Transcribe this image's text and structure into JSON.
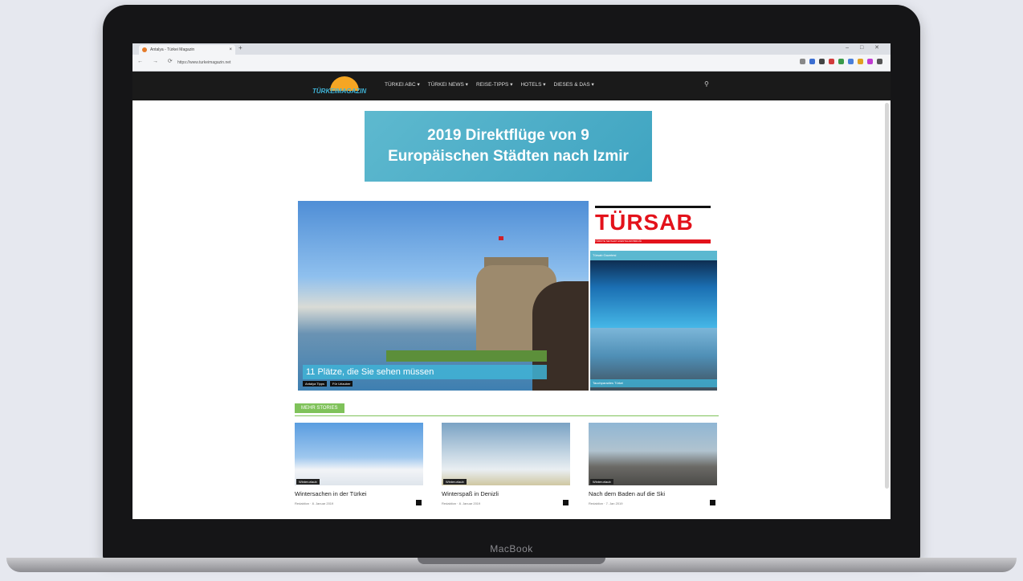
{
  "device": {
    "label": "MacBook"
  },
  "browser": {
    "tab_title": "Antalya - Türkei Magazin",
    "new_tab": "+",
    "window_controls": "– □ ✕",
    "nav_buttons": "← → ⟳",
    "url": "https://www.turkeimagazin.net",
    "extension_colors": [
      "#888888",
      "#3b6ed1",
      "#444444",
      "#d13b3b",
      "#3a9a4a",
      "#4a7fd9",
      "#e0a020",
      "#c03bd1",
      "#555555"
    ]
  },
  "site": {
    "logo_text": "TÜRKEIMAGAZIN",
    "menu": [
      "TÜRKEI ABC ▾",
      "TÜRKEI NEWS ▾",
      "REISE-TIPPS ▾",
      "HOTELS ▾",
      "DIESES & DAS ▾"
    ]
  },
  "banner": {
    "text": "2019 Direktflüge von 9\nEuropäischen Städten nach Izmir"
  },
  "hero": {
    "caption": "11 Plätze, die Sie sehen müssen",
    "tag": "Antalya Tipps",
    "tag2": "Für Urlauber"
  },
  "side": {
    "logo": "TÜRSAB",
    "subline": "TÜRKIYE SEYAHAT ACENTALARI BIRLIĞI",
    "label_top": "Türsab Gazetesi",
    "caption": "Tauchparadies Türkei"
  },
  "section": {
    "badge": "MEHR STORIES",
    "cards": [
      {
        "tag": "Winterurlaub",
        "title": "Wintersachen in der Türkei",
        "meta": "Redaktion · 8. Januar 2019"
      },
      {
        "tag": "Winterurlaub",
        "title": "Winterspaß in Denizli",
        "meta": "Redaktion · 8. Januar 2019"
      },
      {
        "tag": "Winterurlaub",
        "title": "Nach dem Baden auf die Ski",
        "meta": "Redaktion · 7. Jan 2019"
      }
    ]
  }
}
